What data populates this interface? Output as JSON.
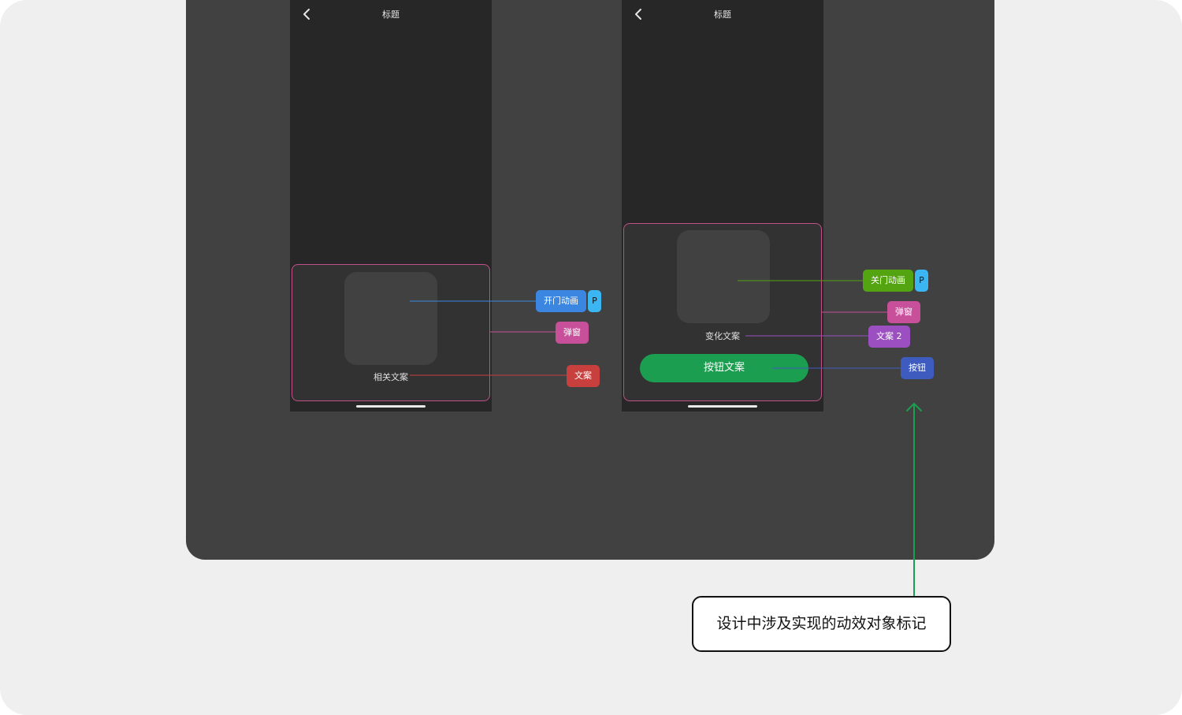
{
  "colors": {
    "anim_tag": "#3a86e0",
    "popup_tag": "#c84f9a",
    "text_tag": "#c8403e",
    "close_anim_tag": "#54a412",
    "text2_tag": "#9b4fc0",
    "button_tag": "#3e5cbf",
    "p_badge": "#3bb6f2",
    "cta_green": "#1b9e50"
  },
  "screen1": {
    "title": "标题",
    "back_icon": "chevron-left-icon",
    "body_text": "相关文案"
  },
  "screen2": {
    "title": "标题",
    "back_icon": "chevron-left-icon",
    "body_text": "变化文案",
    "button_label": "按钮文案"
  },
  "annotations1": {
    "open_anim": "开门动画",
    "p_badge": "P",
    "popup": "弹窗",
    "text": "文案"
  },
  "annotations2": {
    "close_anim": "关门动画",
    "p_badge": "P",
    "popup": "弹窗",
    "text2": "文案 2",
    "button": "按钮"
  },
  "callout": {
    "text": "设计中涉及实现的动效对象标记"
  }
}
